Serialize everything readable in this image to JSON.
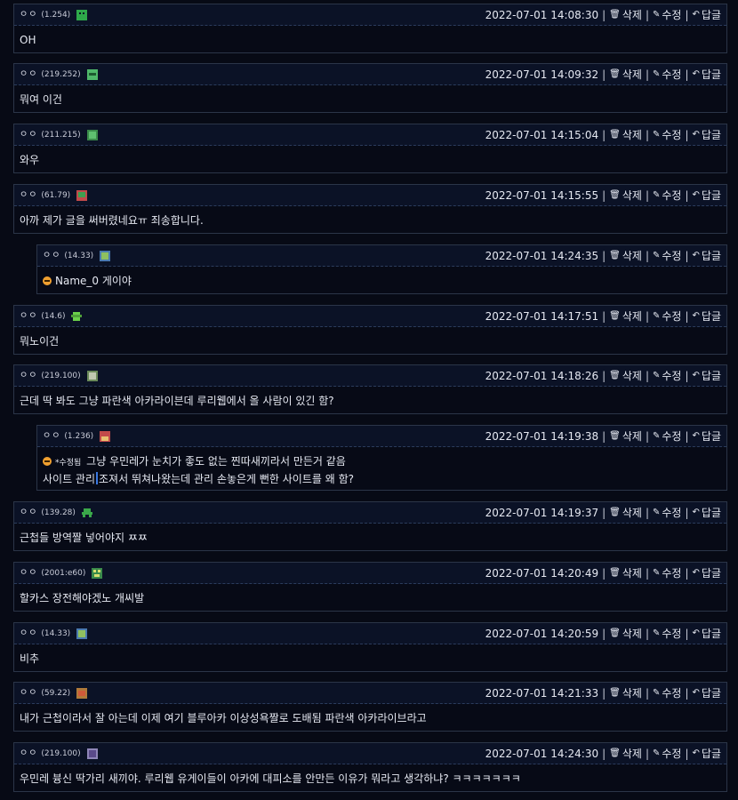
{
  "actions": {
    "delete": "삭제",
    "edit": "수정",
    "reply": "답글"
  },
  "avatar_colors": [
    "#2ea84a",
    "#4fb86a",
    "#6b8a5a",
    "#c24a4a",
    "#8f86b8",
    "#b07a3a"
  ],
  "comments": [
    {
      "nick": "ㅇㅇ",
      "ip": "(1.254)",
      "time": "2022-07-01 14:08:30",
      "body": "OH",
      "reply": false
    },
    {
      "nick": "ㅇㅇ",
      "ip": "(219.252)",
      "time": "2022-07-01 14:09:32",
      "body": "뭐여 이건",
      "reply": false
    },
    {
      "nick": "ㅇㅇ",
      "ip": "(211.215)",
      "time": "2022-07-01 14:15:04",
      "body": "와우",
      "reply": false
    },
    {
      "nick": "ㅇㅇ",
      "ip": "(61.79)",
      "time": "2022-07-01 14:15:55",
      "body": "아까 제가 글을 써버렸네요ㅠ 죄송합니다.",
      "reply": false
    },
    {
      "nick": "ㅇㅇ",
      "ip": "(14.33)",
      "time": "2022-07-01 14:24:35",
      "body": "Name_0 게이야",
      "reply": true,
      "mention": true
    },
    {
      "nick": "ㅇㅇ",
      "ip": "(14.6)",
      "time": "2022-07-01 14:17:51",
      "body": "뭐노이건",
      "reply": false
    },
    {
      "nick": "ㅇㅇ",
      "ip": "(219.100)",
      "time": "2022-07-01 14:18:26",
      "body": "근데 딱 봐도 그냥 파란색 아카라이븐데 루리웹에서 올 사람이 있긴 함?",
      "reply": false
    },
    {
      "nick": "ㅇㅇ",
      "ip": "(1.236)",
      "time": "2022-07-01 14:19:38",
      "edited": "*수정됨",
      "body": "그냥 우민레가 눈치가 좋도 없는 찐따새끼라서 만든거 같음",
      "body2a": "사이트 관리",
      "body2b": "조져서 뛰쳐나왔는데 관리 손놓은게 뻔한 사이트를 왜 함?",
      "reply": true,
      "mention": true
    },
    {
      "nick": "ㅇㅇ",
      "ip": "(139.28)",
      "time": "2022-07-01 14:19:37",
      "body": "근첩들 방역짤 넣어야지 ㅉㅉ",
      "reply": false
    },
    {
      "nick": "ㅇㅇ",
      "ip": "(2001:e60)",
      "time": "2022-07-01 14:20:49",
      "body": "할카스 장전해야겠노 개씨발",
      "reply": false
    },
    {
      "nick": "ㅇㅇ",
      "ip": "(14.33)",
      "time": "2022-07-01 14:20:59",
      "body": "비추",
      "reply": false
    },
    {
      "nick": "ㅇㅇ",
      "ip": "(59.22)",
      "time": "2022-07-01 14:21:33",
      "body": "내가 근첩이라서 잘 아는데 이제 여기 블루아카 이상성욕짤로 도배됨 파란색 아카라이브라고",
      "reply": false
    },
    {
      "nick": "ㅇㅇ",
      "ip": "(219.100)",
      "time": "2022-07-01 14:24:30",
      "body": "우민레 븅신 딱가리 새끼야. 루리웹 유게이들이 아카에 대피소를 안만든 이유가 뭐라고 생각하냐? ㅋㅋㅋㅋㅋㅋㅋ",
      "reply": false
    }
  ]
}
